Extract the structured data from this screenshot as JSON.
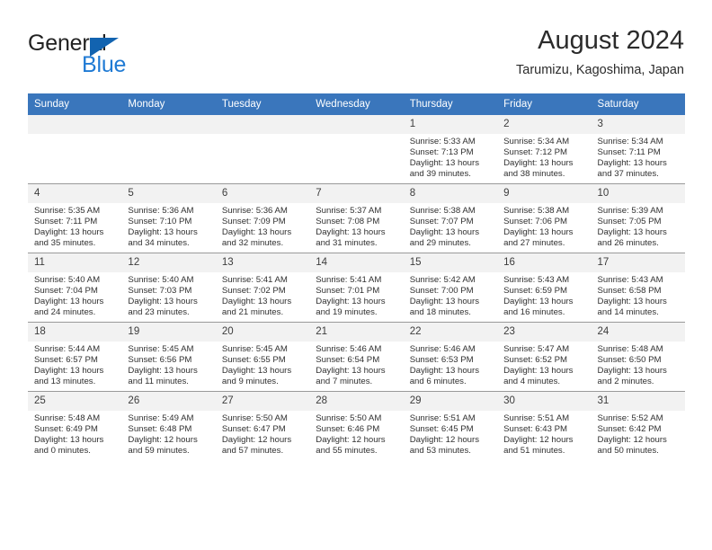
{
  "logo": {
    "word1": "General",
    "word2": "Blue",
    "triangle_color": "#1263b0",
    "blue_color": "#1f7ad4"
  },
  "header": {
    "title": "August 2024",
    "subtitle": "Tarumizu, Kagoshima, Japan",
    "header_bg": "#3a76bc",
    "daynum_bg": "#f2f2f2"
  },
  "weekday_headers": [
    "Sunday",
    "Monday",
    "Tuesday",
    "Wednesday",
    "Thursday",
    "Friday",
    "Saturday"
  ],
  "weeks": [
    [
      {
        "day": "",
        "sunrise": "",
        "sunset": "",
        "daylight_line1": "",
        "daylight_line2": ""
      },
      {
        "day": "",
        "sunrise": "",
        "sunset": "",
        "daylight_line1": "",
        "daylight_line2": ""
      },
      {
        "day": "",
        "sunrise": "",
        "sunset": "",
        "daylight_line1": "",
        "daylight_line2": ""
      },
      {
        "day": "",
        "sunrise": "",
        "sunset": "",
        "daylight_line1": "",
        "daylight_line2": ""
      },
      {
        "day": "1",
        "sunrise": "Sunrise: 5:33 AM",
        "sunset": "Sunset: 7:13 PM",
        "daylight_line1": "Daylight: 13 hours",
        "daylight_line2": "and 39 minutes."
      },
      {
        "day": "2",
        "sunrise": "Sunrise: 5:34 AM",
        "sunset": "Sunset: 7:12 PM",
        "daylight_line1": "Daylight: 13 hours",
        "daylight_line2": "and 38 minutes."
      },
      {
        "day": "3",
        "sunrise": "Sunrise: 5:34 AM",
        "sunset": "Sunset: 7:11 PM",
        "daylight_line1": "Daylight: 13 hours",
        "daylight_line2": "and 37 minutes."
      }
    ],
    [
      {
        "day": "4",
        "sunrise": "Sunrise: 5:35 AM",
        "sunset": "Sunset: 7:11 PM",
        "daylight_line1": "Daylight: 13 hours",
        "daylight_line2": "and 35 minutes."
      },
      {
        "day": "5",
        "sunrise": "Sunrise: 5:36 AM",
        "sunset": "Sunset: 7:10 PM",
        "daylight_line1": "Daylight: 13 hours",
        "daylight_line2": "and 34 minutes."
      },
      {
        "day": "6",
        "sunrise": "Sunrise: 5:36 AM",
        "sunset": "Sunset: 7:09 PM",
        "daylight_line1": "Daylight: 13 hours",
        "daylight_line2": "and 32 minutes."
      },
      {
        "day": "7",
        "sunrise": "Sunrise: 5:37 AM",
        "sunset": "Sunset: 7:08 PM",
        "daylight_line1": "Daylight: 13 hours",
        "daylight_line2": "and 31 minutes."
      },
      {
        "day": "8",
        "sunrise": "Sunrise: 5:38 AM",
        "sunset": "Sunset: 7:07 PM",
        "daylight_line1": "Daylight: 13 hours",
        "daylight_line2": "and 29 minutes."
      },
      {
        "day": "9",
        "sunrise": "Sunrise: 5:38 AM",
        "sunset": "Sunset: 7:06 PM",
        "daylight_line1": "Daylight: 13 hours",
        "daylight_line2": "and 27 minutes."
      },
      {
        "day": "10",
        "sunrise": "Sunrise: 5:39 AM",
        "sunset": "Sunset: 7:05 PM",
        "daylight_line1": "Daylight: 13 hours",
        "daylight_line2": "and 26 minutes."
      }
    ],
    [
      {
        "day": "11",
        "sunrise": "Sunrise: 5:40 AM",
        "sunset": "Sunset: 7:04 PM",
        "daylight_line1": "Daylight: 13 hours",
        "daylight_line2": "and 24 minutes."
      },
      {
        "day": "12",
        "sunrise": "Sunrise: 5:40 AM",
        "sunset": "Sunset: 7:03 PM",
        "daylight_line1": "Daylight: 13 hours",
        "daylight_line2": "and 23 minutes."
      },
      {
        "day": "13",
        "sunrise": "Sunrise: 5:41 AM",
        "sunset": "Sunset: 7:02 PM",
        "daylight_line1": "Daylight: 13 hours",
        "daylight_line2": "and 21 minutes."
      },
      {
        "day": "14",
        "sunrise": "Sunrise: 5:41 AM",
        "sunset": "Sunset: 7:01 PM",
        "daylight_line1": "Daylight: 13 hours",
        "daylight_line2": "and 19 minutes."
      },
      {
        "day": "15",
        "sunrise": "Sunrise: 5:42 AM",
        "sunset": "Sunset: 7:00 PM",
        "daylight_line1": "Daylight: 13 hours",
        "daylight_line2": "and 18 minutes."
      },
      {
        "day": "16",
        "sunrise": "Sunrise: 5:43 AM",
        "sunset": "Sunset: 6:59 PM",
        "daylight_line1": "Daylight: 13 hours",
        "daylight_line2": "and 16 minutes."
      },
      {
        "day": "17",
        "sunrise": "Sunrise: 5:43 AM",
        "sunset": "Sunset: 6:58 PM",
        "daylight_line1": "Daylight: 13 hours",
        "daylight_line2": "and 14 minutes."
      }
    ],
    [
      {
        "day": "18",
        "sunrise": "Sunrise: 5:44 AM",
        "sunset": "Sunset: 6:57 PM",
        "daylight_line1": "Daylight: 13 hours",
        "daylight_line2": "and 13 minutes."
      },
      {
        "day": "19",
        "sunrise": "Sunrise: 5:45 AM",
        "sunset": "Sunset: 6:56 PM",
        "daylight_line1": "Daylight: 13 hours",
        "daylight_line2": "and 11 minutes."
      },
      {
        "day": "20",
        "sunrise": "Sunrise: 5:45 AM",
        "sunset": "Sunset: 6:55 PM",
        "daylight_line1": "Daylight: 13 hours",
        "daylight_line2": "and 9 minutes."
      },
      {
        "day": "21",
        "sunrise": "Sunrise: 5:46 AM",
        "sunset": "Sunset: 6:54 PM",
        "daylight_line1": "Daylight: 13 hours",
        "daylight_line2": "and 7 minutes."
      },
      {
        "day": "22",
        "sunrise": "Sunrise: 5:46 AM",
        "sunset": "Sunset: 6:53 PM",
        "daylight_line1": "Daylight: 13 hours",
        "daylight_line2": "and 6 minutes."
      },
      {
        "day": "23",
        "sunrise": "Sunrise: 5:47 AM",
        "sunset": "Sunset: 6:52 PM",
        "daylight_line1": "Daylight: 13 hours",
        "daylight_line2": "and 4 minutes."
      },
      {
        "day": "24",
        "sunrise": "Sunrise: 5:48 AM",
        "sunset": "Sunset: 6:50 PM",
        "daylight_line1": "Daylight: 13 hours",
        "daylight_line2": "and 2 minutes."
      }
    ],
    [
      {
        "day": "25",
        "sunrise": "Sunrise: 5:48 AM",
        "sunset": "Sunset: 6:49 PM",
        "daylight_line1": "Daylight: 13 hours",
        "daylight_line2": "and 0 minutes."
      },
      {
        "day": "26",
        "sunrise": "Sunrise: 5:49 AM",
        "sunset": "Sunset: 6:48 PM",
        "daylight_line1": "Daylight: 12 hours",
        "daylight_line2": "and 59 minutes."
      },
      {
        "day": "27",
        "sunrise": "Sunrise: 5:50 AM",
        "sunset": "Sunset: 6:47 PM",
        "daylight_line1": "Daylight: 12 hours",
        "daylight_line2": "and 57 minutes."
      },
      {
        "day": "28",
        "sunrise": "Sunrise: 5:50 AM",
        "sunset": "Sunset: 6:46 PM",
        "daylight_line1": "Daylight: 12 hours",
        "daylight_line2": "and 55 minutes."
      },
      {
        "day": "29",
        "sunrise": "Sunrise: 5:51 AM",
        "sunset": "Sunset: 6:45 PM",
        "daylight_line1": "Daylight: 12 hours",
        "daylight_line2": "and 53 minutes."
      },
      {
        "day": "30",
        "sunrise": "Sunrise: 5:51 AM",
        "sunset": "Sunset: 6:43 PM",
        "daylight_line1": "Daylight: 12 hours",
        "daylight_line2": "and 51 minutes."
      },
      {
        "day": "31",
        "sunrise": "Sunrise: 5:52 AM",
        "sunset": "Sunset: 6:42 PM",
        "daylight_line1": "Daylight: 12 hours",
        "daylight_line2": "and 50 minutes."
      }
    ]
  ]
}
